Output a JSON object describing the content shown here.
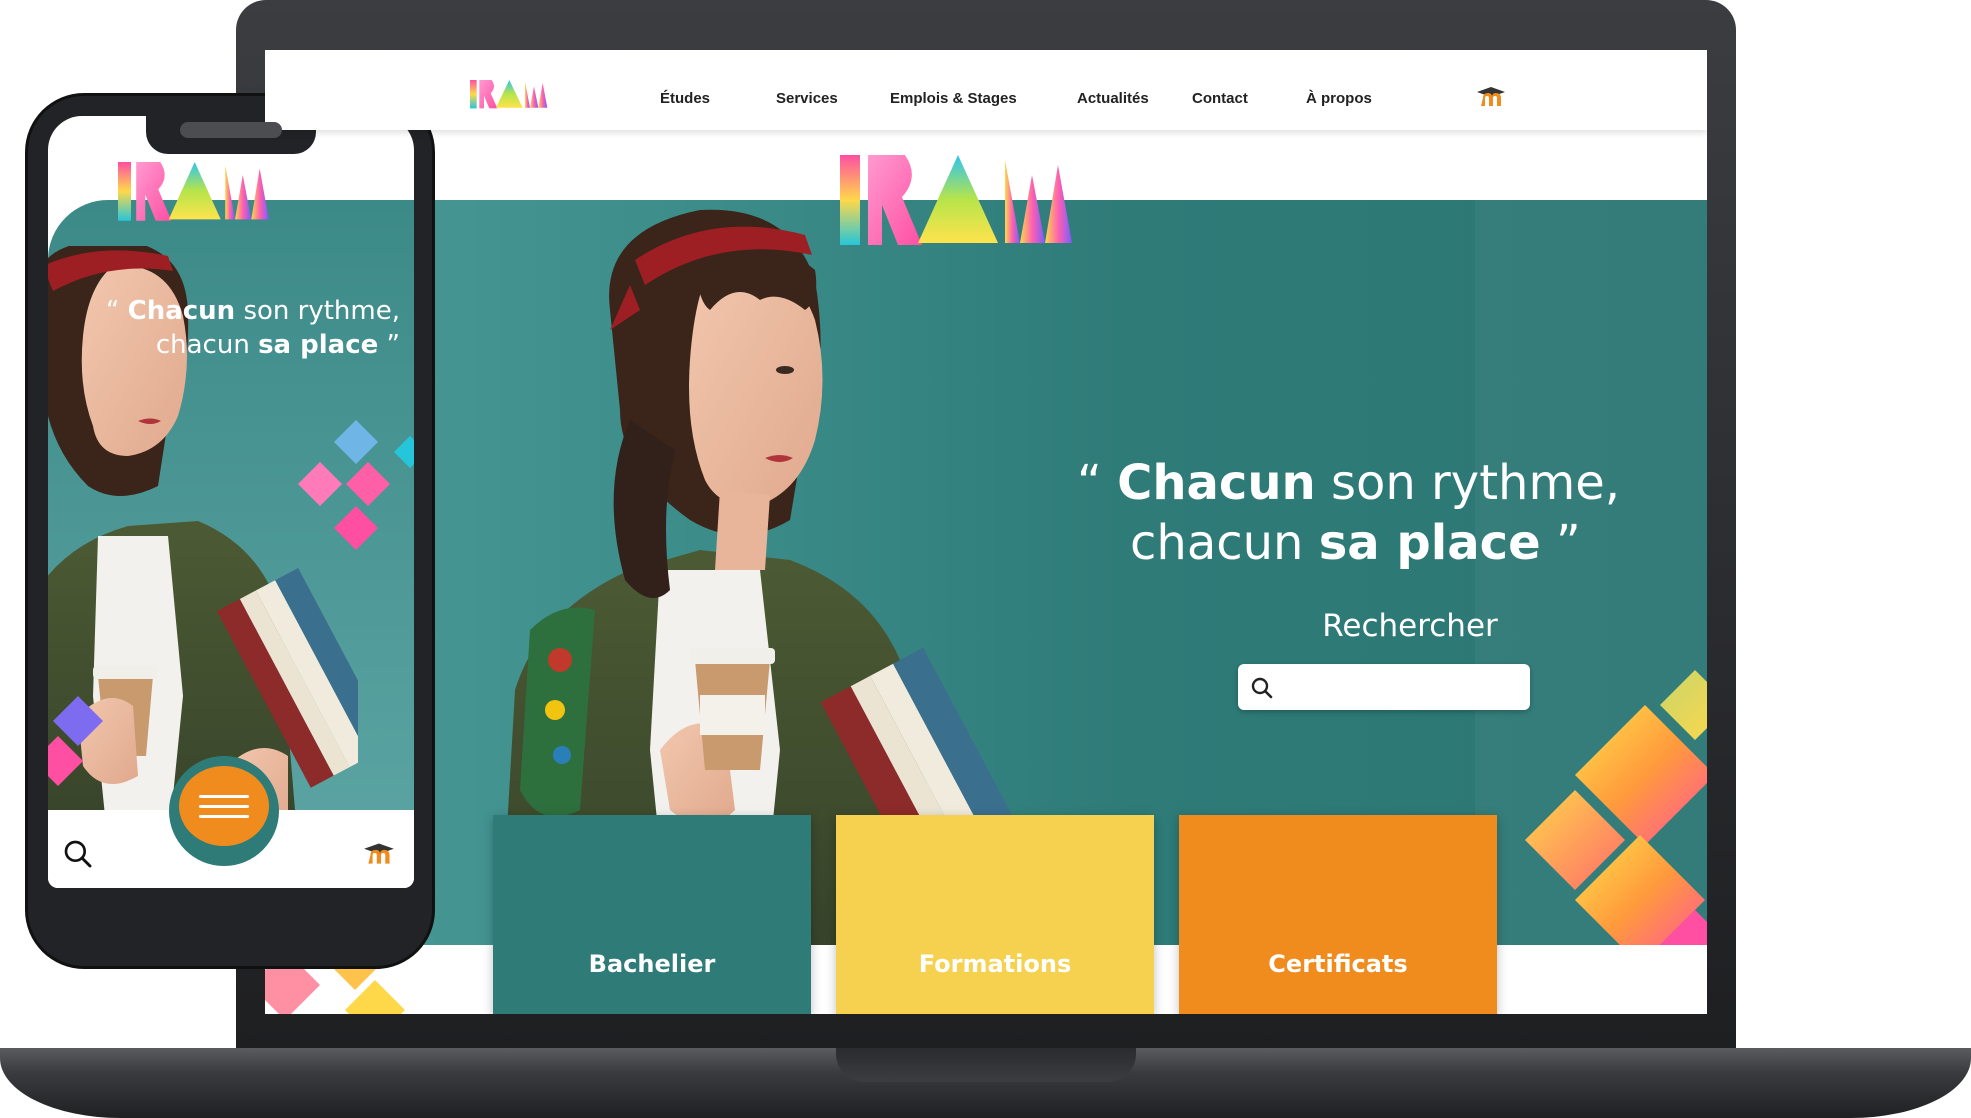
{
  "brand": {
    "name": "IRAM",
    "colors": {
      "teal": "#2e7b78",
      "yellow": "#f6d150",
      "orange": "#f08c1e",
      "pink": "#ff4fa3",
      "cyan": "#26c6da"
    }
  },
  "nav": {
    "items": [
      {
        "label": "Études"
      },
      {
        "label": "Services"
      },
      {
        "label": "Emplois & Stages"
      },
      {
        "label": "Actualités"
      },
      {
        "label": "Contact"
      },
      {
        "label": "À propos"
      }
    ],
    "platform_icon": "moodle-icon"
  },
  "hero": {
    "quote_open": "“",
    "quote_word1": "Chacun",
    "quote_rest1": "son rythme,",
    "quote_word2": "chacun",
    "quote_bold2": "sa place",
    "quote_close": "”",
    "search_title": "Rechercher",
    "search_placeholder": "",
    "search_icon": "search-icon"
  },
  "categories": [
    {
      "label": "Bachelier",
      "color": "#2e7b78"
    },
    {
      "label": "Formations",
      "color": "#f6d150"
    },
    {
      "label": "Certificats",
      "color": "#f08c1e"
    }
  ],
  "mobile": {
    "quote_line1_bold": "Chacun",
    "quote_line1_rest": "son rythme,",
    "quote_line2_light": "chacun",
    "quote_line2_bold": "sa place",
    "menu_icon": "hamburger-icon",
    "search_icon": "search-icon",
    "platform_icon": "moodle-icon"
  }
}
